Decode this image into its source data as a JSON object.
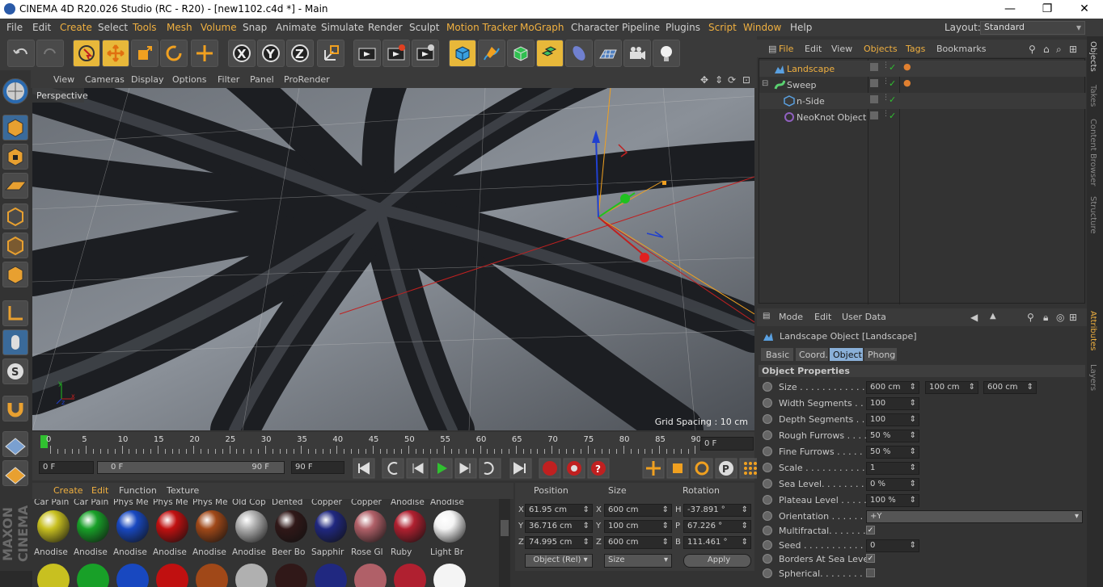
{
  "title": "CINEMA 4D R20.026 Studio (RC - R20) - [new1102.c4d *] - Main",
  "menu": [
    "File",
    "Edit",
    "Create",
    "Select",
    "Tools",
    "Mesh",
    "Volume",
    "Snap",
    "Animate",
    "Simulate",
    "Render",
    "Sculpt",
    "Motion Tracker",
    "MoGraph",
    "Character",
    "Pipeline",
    "Plugins",
    "Script",
    "Window",
    "Help"
  ],
  "layout": {
    "label": "Layout:",
    "value": "Standard"
  },
  "viewport": {
    "menu": [
      "View",
      "Cameras",
      "Display",
      "Options",
      "Filter",
      "Panel",
      "ProRender"
    ],
    "label": "Perspective",
    "grid": "Grid Spacing : 10 cm"
  },
  "timeline": {
    "ticks": [
      "0",
      "5",
      "10",
      "15",
      "20",
      "25",
      "30",
      "35",
      "40",
      "45",
      "50",
      "55",
      "60",
      "65",
      "70",
      "75",
      "80",
      "85",
      "90"
    ],
    "frame": "0 F",
    "start": "0 F",
    "range_start": "0 F",
    "range_end": "90 F",
    "end": "90 F"
  },
  "materials": {
    "menu": [
      "Create",
      "Edit",
      "Function",
      "Texture"
    ],
    "row_top": [
      "Car Pain",
      "Car Pain",
      "Phys Me",
      "Phys Me",
      "Phys Me",
      "Old Cop",
      "Dented",
      "Copper",
      "Copper",
      "Anodise",
      "Anodise"
    ],
    "row": [
      {
        "name": "Anodise",
        "color": "#c8c020"
      },
      {
        "name": "Anodise",
        "color": "#18a028"
      },
      {
        "name": "Anodise",
        "color": "#1848c0"
      },
      {
        "name": "Anodise",
        "color": "#c01010"
      },
      {
        "name": "Anodise",
        "color": "#a04818"
      },
      {
        "name": "Anodise",
        "color": "#b0b0b0"
      },
      {
        "name": "Beer Bo",
        "color": "#301818"
      },
      {
        "name": "Sapphir",
        "color": "#202880"
      },
      {
        "name": "Rose Gl",
        "color": "#b06068"
      },
      {
        "name": "Ruby",
        "color": "#b02030"
      },
      {
        "name": "Light Br",
        "color": "#f4f4f4"
      }
    ]
  },
  "coords": {
    "headers": [
      "Position",
      "Size",
      "Rotation"
    ],
    "rows": [
      {
        "a": "X",
        "pos": "61.95 cm",
        "b": "X",
        "size": "600 cm",
        "c": "H",
        "rot": "-37.891 °"
      },
      {
        "a": "Y",
        "pos": "36.716 cm",
        "b": "Y",
        "size": "100 cm",
        "c": "P",
        "rot": "67.226 °"
      },
      {
        "a": "Z",
        "pos": "74.995 cm",
        "b": "Z",
        "size": "600 cm",
        "c": "B",
        "rot": "111.461 °"
      }
    ],
    "mode": "Object (Rel)",
    "sizemode": "Size",
    "apply": "Apply"
  },
  "objects": {
    "menu": [
      "File",
      "Edit",
      "View",
      "Objects",
      "Tags",
      "Bookmarks"
    ],
    "items": [
      {
        "name": "Landscape",
        "indent": 0,
        "selected": true
      },
      {
        "name": "Sweep",
        "indent": 0,
        "selected": false
      },
      {
        "name": "n-Side",
        "indent": 1,
        "selected": false
      },
      {
        "name": "NeoKnot Object",
        "indent": 1,
        "selected": false
      }
    ]
  },
  "attributes": {
    "menu": [
      "Mode",
      "Edit",
      "User Data"
    ],
    "object": "Landscape Object [Landscape]",
    "tabs": [
      "Basic",
      "Coord.",
      "Object",
      "Phong"
    ],
    "active_tab": "Object",
    "section": "Object Properties",
    "rows": [
      {
        "label": "Size . . . . . . . . . . . . . . .",
        "v1": "600 cm",
        "v2": "100 cm",
        "v3": "600 cm"
      },
      {
        "label": "Width Segments . . .",
        "v1": "100"
      },
      {
        "label": "Depth Segments . . .",
        "v1": "100"
      },
      {
        "label": "Rough Furrows . . . .",
        "v1": "50 %"
      },
      {
        "label": "Fine Furrows . . . . .",
        "v1": "50 %"
      },
      {
        "label": "Scale . . . . . . . . . . . . .",
        "v1": "1"
      },
      {
        "label": "Sea Level. . . . . . . . .",
        "v1": "0 %"
      },
      {
        "label": "Plateau Level . . . . .",
        "v1": "100 %"
      },
      {
        "label": "Orientation . . . . . . .",
        "v1": "+Y",
        "wide": true
      },
      {
        "label": "Multifractal. . . . . . .",
        "check": true
      },
      {
        "label": "Seed . . . . . . . . . . . .",
        "v1": "0"
      },
      {
        "label": "Borders At Sea Level",
        "check": true
      },
      {
        "label": "Spherical. . . . . . . . .",
        "check": false
      }
    ]
  },
  "side_tabs": [
    "Objects",
    "Takes",
    "Content Browser",
    "Structure",
    "Attributes",
    "Layers"
  ],
  "brand": "MAXON CINEMA 4D"
}
